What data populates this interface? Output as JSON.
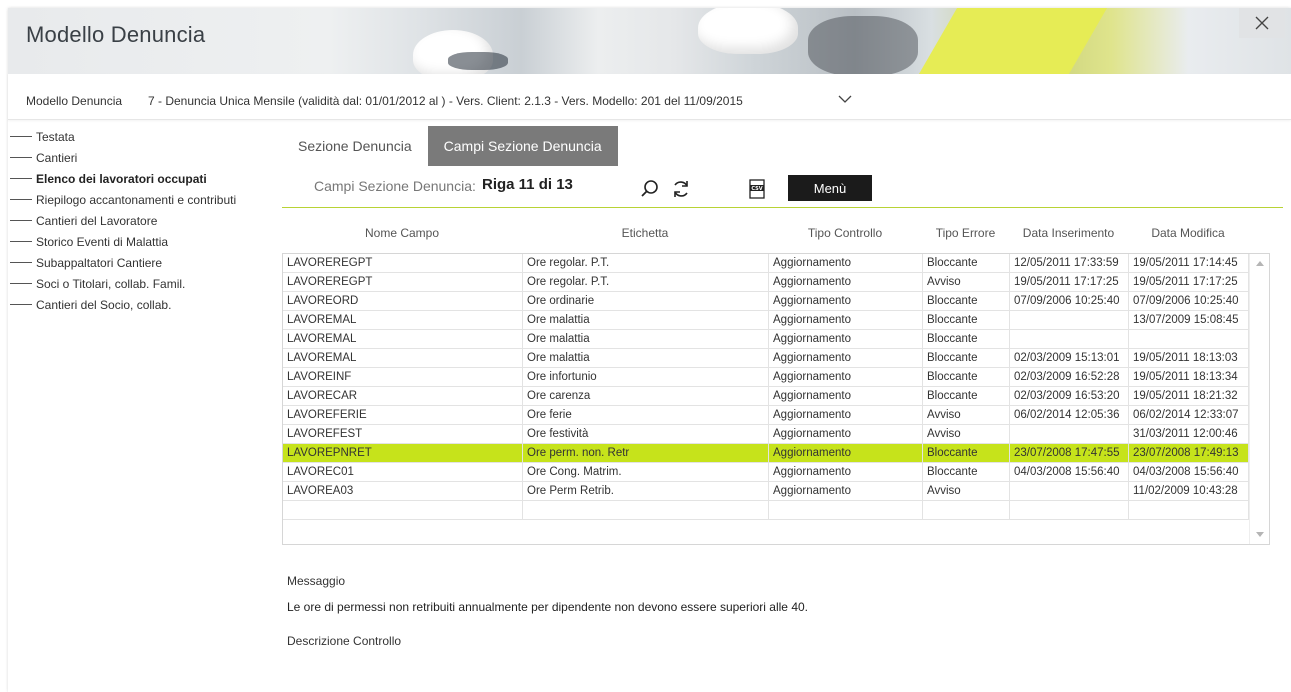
{
  "app": {
    "title": "Modello Denuncia"
  },
  "model_bar": {
    "label": "Modello Denuncia",
    "selected_value": "7 - Denuncia Unica Mensile (validità dal: 01/01/2012 al ) - Vers. Client: 2.1.3 - Vers. Modello: 201 del 11/09/2015"
  },
  "sidebar": {
    "items": [
      {
        "label": "Testata",
        "active": false
      },
      {
        "label": "Cantieri",
        "active": false
      },
      {
        "label": "Elenco dei lavoratori occupati",
        "active": true
      },
      {
        "label": "Riepilogo accantonamenti e contributi",
        "active": false
      },
      {
        "label": "Cantieri del Lavoratore",
        "active": false
      },
      {
        "label": "Storico Eventi di Malattia",
        "active": false
      },
      {
        "label": "Subappaltatori Cantiere",
        "active": false
      },
      {
        "label": "Soci o Titolari, collab. Famil.",
        "active": false
      },
      {
        "label": "Cantieri del Socio, collab.",
        "active": false
      }
    ]
  },
  "tabs": [
    {
      "label": "Sezione Denuncia",
      "active": false
    },
    {
      "label": "Campi Sezione Denuncia",
      "active": true
    }
  ],
  "record_bar": {
    "label": "Campi Sezione Denuncia:",
    "value": "Riga 11 di 13",
    "menu_label": "Menù",
    "icons": [
      "search-icon",
      "refresh-icon",
      "csv-export-icon"
    ]
  },
  "grid": {
    "columns": [
      "Nome Campo",
      "Etichetta",
      "Tipo Controllo",
      "Tipo Errore",
      "Data Inserimento",
      "Data Modifica"
    ],
    "selected_row": 10,
    "rows": [
      [
        "LAVOREREGPT",
        "Ore regolar. P.T.",
        "Aggiornamento",
        "Bloccante",
        "12/05/2011 17:33:59",
        "19/05/2011 17:14:45"
      ],
      [
        "LAVOREREGPT",
        "Ore regolar. P.T.",
        "Aggiornamento",
        "Avviso",
        "19/05/2011 17:17:25",
        "19/05/2011 17:17:25"
      ],
      [
        "LAVOREORD",
        "Ore ordinarie",
        "Aggiornamento",
        "Bloccante",
        "07/09/2006 10:25:40",
        "07/09/2006 10:25:40"
      ],
      [
        "LAVOREMAL",
        "Ore malattia",
        "Aggiornamento",
        "Bloccante",
        "",
        "13/07/2009 15:08:45"
      ],
      [
        "LAVOREMAL",
        "Ore malattia",
        "Aggiornamento",
        "Bloccante",
        "",
        ""
      ],
      [
        "LAVOREMAL",
        "Ore malattia",
        "Aggiornamento",
        "Bloccante",
        "02/03/2009 15:13:01",
        "19/05/2011 18:13:03"
      ],
      [
        "LAVOREINF",
        "Ore infortunio",
        "Aggiornamento",
        "Bloccante",
        "02/03/2009 16:52:28",
        "19/05/2011 18:13:34"
      ],
      [
        "LAVORECAR",
        "Ore carenza",
        "Aggiornamento",
        "Bloccante",
        "02/03/2009 16:53:20",
        "19/05/2011 18:21:32"
      ],
      [
        "LAVOREFERIE",
        "Ore ferie",
        "Aggiornamento",
        "Avviso",
        "06/02/2014 12:05:36",
        "06/02/2014 12:33:07"
      ],
      [
        "LAVOREFEST",
        "Ore festività",
        "Aggiornamento",
        "Avviso",
        "",
        "31/03/2011 12:00:46"
      ],
      [
        "LAVOREPNRET",
        "Ore perm. non. Retr",
        "Aggiornamento",
        "Bloccante",
        "23/07/2008 17:47:55",
        "23/07/2008 17:49:13"
      ],
      [
        "LAVOREC01",
        "Ore Cong. Matrim.",
        "Aggiornamento",
        "Bloccante",
        "04/03/2008 15:56:40",
        "04/03/2008 15:56:40"
      ],
      [
        "LAVOREA03",
        "Ore Perm Retrib.",
        "Aggiornamento",
        "Avviso",
        "",
        "11/02/2009 10:43:28"
      ],
      [
        "",
        "",
        "",
        "",
        "",
        ""
      ]
    ]
  },
  "message": {
    "title": "Messaggio",
    "text": "Le ore di permessi non retribuiti annualmente per dipendente non devono essere superiori alle 40.",
    "description_title": "Descrizione Controllo"
  },
  "colors": {
    "accent": "#b8d335",
    "selected_row": "#c6e31b",
    "active_tab": "#7a7a7a",
    "menu_button": "#1b1b1b"
  }
}
